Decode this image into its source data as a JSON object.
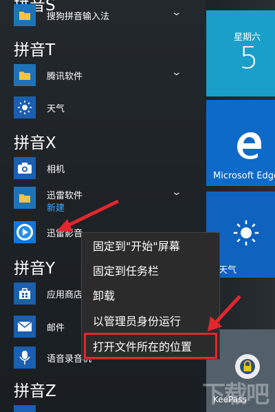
{
  "app_list": {
    "header_top_partial": "拼音S",
    "sections": [
      {
        "header": "拼音T"
      },
      {
        "header": "拼音X"
      },
      {
        "header": "拼音Y"
      },
      {
        "header": "拼音Z"
      }
    ],
    "apps": {
      "sogou": {
        "label": "搜狗拼音输入法",
        "icon": "folder-icon"
      },
      "tencent": {
        "label": "腾讯软件",
        "icon": "folder-icon"
      },
      "weather": {
        "label": "天气",
        "icon": "sun-icon"
      },
      "camera": {
        "label": "相机",
        "icon": "camera-icon"
      },
      "xunlei_soft": {
        "label": "迅雷软件",
        "sub_label": "新建",
        "icon": "folder-icon"
      },
      "xunlei_yingyin": {
        "label": "迅雷影音",
        "icon": "player-icon"
      },
      "store": {
        "label": "应用商店",
        "icon": "store-icon"
      },
      "mail": {
        "label": "邮件",
        "icon": "mail-icon"
      },
      "voice": {
        "label": "语音录音机",
        "icon": "mic-icon"
      }
    }
  },
  "tiles": {
    "calendar": {
      "weekday": "星期六",
      "day": "5"
    },
    "edge": {
      "label": "Microsoft Edge"
    },
    "weather": {
      "label": "天气"
    },
    "keepass": {
      "label": "KeePass"
    }
  },
  "context_menu": {
    "items": [
      {
        "label": "固定到\"开始\"屏幕"
      },
      {
        "label": "固定到任务栏"
      },
      {
        "label": "卸载"
      },
      {
        "label": "以管理员身份运行"
      },
      {
        "label": "打开文件所在的位置"
      }
    ]
  },
  "watermark": "下载吧",
  "colors": {
    "accent": "#1e73b8",
    "highlight": "#e3262e",
    "annotation_arrow": "#e3262e"
  }
}
